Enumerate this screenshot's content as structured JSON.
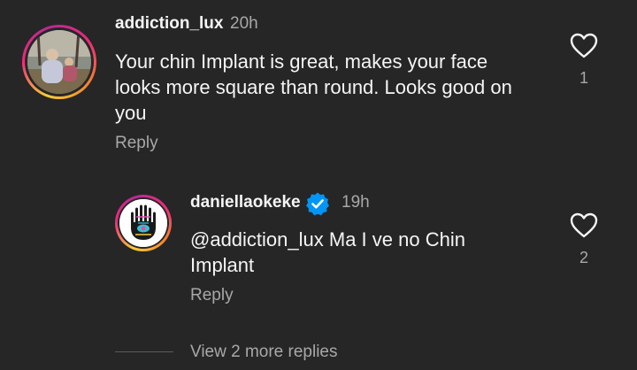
{
  "comment": {
    "username": "addiction_lux",
    "time": "20h",
    "text": "Your chin Implant is great, makes your face looks more square than round. Looks good on you",
    "reply_label": "Reply",
    "likes": "1",
    "avatar_icon": "user-photo"
  },
  "reply": {
    "username": "daniellaokeke",
    "verified_icon": "verified-badge-icon",
    "time": "19h",
    "text": "@addiction_lux Ma I ve no Chin Implant",
    "reply_label": "Reply",
    "likes": "2",
    "avatar_icon": "hamsa-hand"
  },
  "view_more": {
    "label": "View 2 more replies"
  },
  "colors": {
    "background": "#262626",
    "primary_text": "#f5f5f5",
    "secondary_text": "#a8a8a8",
    "verified": "#0095f6"
  }
}
